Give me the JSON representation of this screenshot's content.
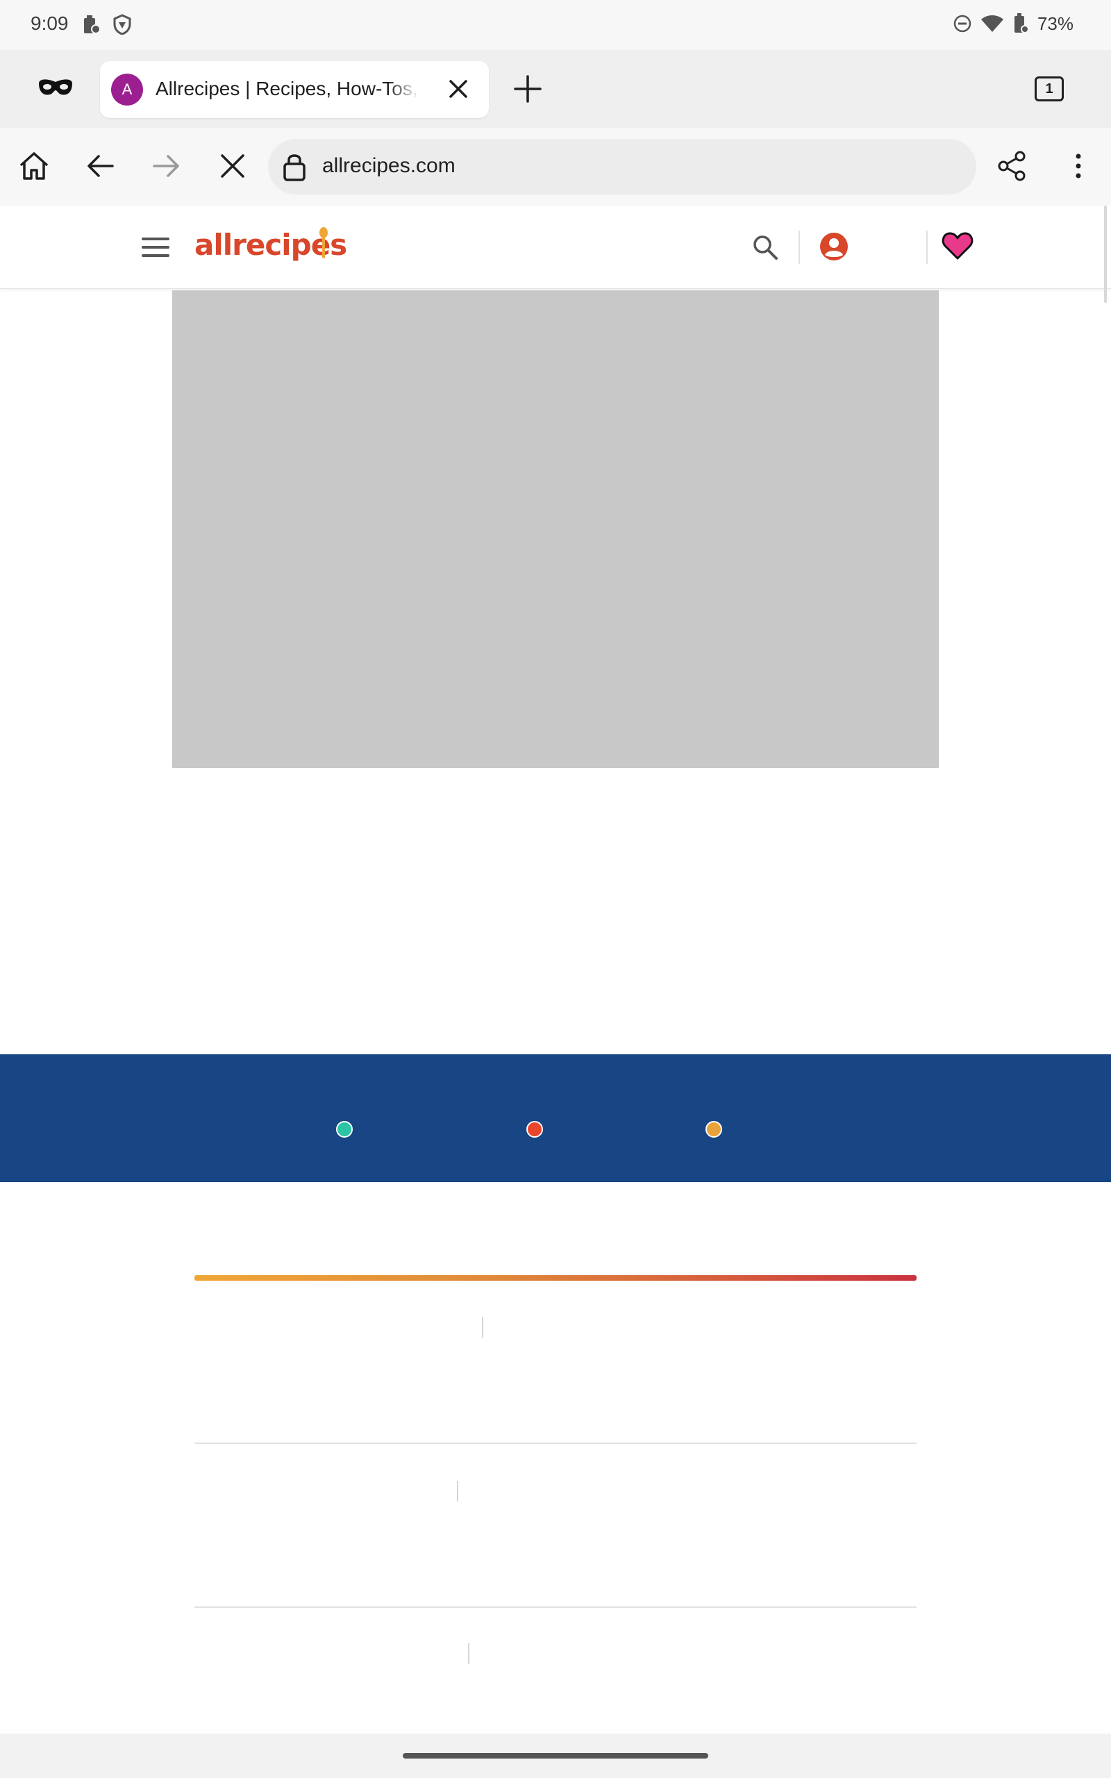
{
  "status_bar": {
    "time": "9:09",
    "battery": "73%"
  },
  "browser": {
    "tab": {
      "favicon_letter": "A",
      "title": "Allrecipes | Recipes, How-Tos, Videos and More"
    },
    "tab_count": "1",
    "address_bar": {
      "url": "allrecipes.com"
    }
  },
  "site": {
    "logo_text": "allrecipes"
  },
  "colors": {
    "banner_bg": "#184584",
    "dot_teal": "#2bc4a4",
    "dot_red": "#e8452c",
    "dot_orange": "#e8a23a",
    "logo": "#d8472a",
    "heart": "#e8398a"
  },
  "icons": [
    "incognito-icon",
    "close-icon",
    "plus-icon",
    "home-icon",
    "back-arrow-icon",
    "forward-arrow-icon",
    "stop-loading-icon",
    "lock-icon",
    "share-icon",
    "more-vert-icon",
    "menu-icon",
    "search-icon",
    "account-icon",
    "heart-icon"
  ]
}
